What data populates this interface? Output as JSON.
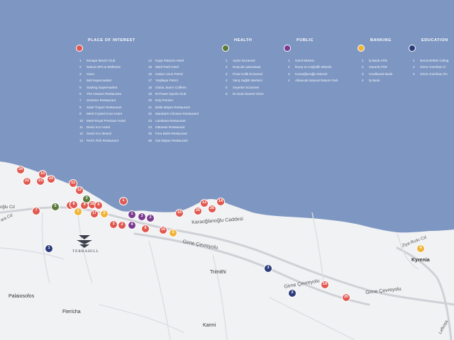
{
  "colors": {
    "sea": "#7e97c2",
    "land": "#f1f2f4",
    "interest": "#e0584f",
    "health": "#5a7a3a",
    "public": "#7b3a8f",
    "banking": "#f0b43a",
    "education": "#2b3a7a"
  },
  "legend": {
    "interest": {
      "title": "PLACE OF INTEREST",
      "col1": [
        {
          "n": "1",
          "label": "Escape Beach Club"
        },
        {
          "n": "2",
          "label": "Natura SPA & Wellness"
        },
        {
          "n": "3",
          "label": "Gavo"
        },
        {
          "n": "4",
          "label": "Beli Supermarket"
        },
        {
          "n": "5",
          "label": "Starling Supermarket"
        },
        {
          "n": "6",
          "label": "The Heaven Restaurant"
        },
        {
          "n": "7",
          "label": "Sommer Restaurant"
        },
        {
          "n": "8",
          "label": "Saint Tropez Restaurant"
        },
        {
          "n": "9",
          "label": "Merit Crystal Cove Hotel"
        },
        {
          "n": "10",
          "label": "Merit Royal Premium Hotel"
        },
        {
          "n": "11",
          "label": "Deniz Kızı Hotel"
        },
        {
          "n": "12",
          "label": "Deniz Kızı Beach"
        },
        {
          "n": "13",
          "label": "Peri's Fish Restaurant"
        }
      ],
      "col2": [
        {
          "n": "14",
          "label": "Kaya Palazzo Hotel"
        },
        {
          "n": "15",
          "label": "Merit Park Hotel"
        },
        {
          "n": "16",
          "label": "Hasan Uzun Petrol"
        },
        {
          "n": "17",
          "label": "Yeşiltepe Petrol"
        },
        {
          "n": "18",
          "label": "Gloria Jean's Coffees"
        },
        {
          "n": "19",
          "label": "M Power Sports Club"
        },
        {
          "n": "20",
          "label": "Eriş Premier"
        },
        {
          "n": "21",
          "label": "Bella Italyan Restaurant"
        },
        {
          "n": "22",
          "label": "Mandarin Chinese Restaurant"
        },
        {
          "n": "23",
          "label": "Lambusa Restaurant"
        },
        {
          "n": "24",
          "label": "Ottoman Restaurant"
        },
        {
          "n": "25",
          "label": "Fora Balık Restaurant"
        },
        {
          "n": "26",
          "label": "Gia İtalyan Restaurant"
        }
      ]
    },
    "health": {
      "title": "HEALTH",
      "items": [
        {
          "n": "1",
          "label": "Aydın Eczanesi"
        },
        {
          "n": "2",
          "label": "DuoLab Laboratuar"
        },
        {
          "n": "3",
          "label": "Pınar Kolik Eczanesi"
        },
        {
          "n": "4",
          "label": "Varış Sağlık Merkezi"
        },
        {
          "n": "5",
          "label": "Seyerler Eczanesi"
        },
        {
          "n": "6",
          "label": "Dr.Suat Günsel Girne"
        }
      ]
    },
    "public": {
      "title": "PUBLIC",
      "items": [
        {
          "n": "1",
          "label": "Gemi Müzesi"
        },
        {
          "n": "2",
          "label": "İkonş ve Coğrafik Müzesi"
        },
        {
          "n": "3",
          "label": "Karaoğlanoğlu Müzesi"
        },
        {
          "n": "4",
          "label": "Alkancak Natural Nature Park"
        }
      ]
    },
    "banking": {
      "title": "BANKING",
      "items": [
        {
          "n": "1",
          "label": "İş Bank ATM"
        },
        {
          "n": "2",
          "label": "Garanti ATM"
        },
        {
          "n": "3",
          "label": "Creditwest Bank"
        },
        {
          "n": "4",
          "label": "İş Bank"
        }
      ]
    },
    "education": {
      "title": "EDUCATION",
      "items": [
        {
          "n": "1",
          "label": "Necat British Colleg"
        },
        {
          "n": "2",
          "label": "Girne Amerikan Ü"
        },
        {
          "n": "3",
          "label": "Girne Amerikan Ün"
        }
      ]
    }
  },
  "places": [
    {
      "name": "Palaiosofos"
    },
    {
      "name": "Fterícha"
    },
    {
      "name": "Trimithi"
    },
    {
      "name": "Karmi"
    },
    {
      "name": "Kyrenia"
    }
  ],
  "roads": [
    {
      "name": "Karaoğlanoğlu Caddesi"
    },
    {
      "name": "Girne Çevreyolu"
    },
    {
      "name": "Girne Çevreyolu"
    },
    {
      "name": "Girne Çevreyolu"
    },
    {
      "name": "Ziya Rızkı Cd"
    },
    {
      "name": "oğlu Cd"
    },
    {
      "name": "ara Cd"
    },
    {
      "name": "Lefkoşa"
    }
  ],
  "logo": {
    "text": "TERRAHILL"
  },
  "markers": [
    {
      "cat": "interest",
      "n": "24"
    },
    {
      "cat": "interest",
      "n": "21"
    },
    {
      "cat": "interest",
      "n": "10"
    },
    {
      "cat": "interest",
      "n": "23"
    },
    {
      "cat": "interest",
      "n": "22"
    },
    {
      "cat": "interest",
      "n": "11"
    },
    {
      "cat": "interest",
      "n": "12"
    },
    {
      "cat": "interest",
      "n": "5"
    },
    {
      "cat": "interest",
      "n": "8"
    },
    {
      "cat": "interest",
      "n": "4"
    },
    {
      "cat": "interest",
      "n": "18"
    },
    {
      "cat": "interest",
      "n": "6"
    },
    {
      "cat": "interest",
      "n": "17"
    },
    {
      "cat": "interest",
      "n": "7"
    },
    {
      "cat": "interest",
      "n": "1"
    },
    {
      "cat": "interest",
      "n": "3"
    },
    {
      "cat": "interest",
      "n": "2"
    },
    {
      "cat": "interest",
      "n": "6"
    },
    {
      "cat": "interest",
      "n": "16"
    },
    {
      "cat": "interest",
      "n": "15"
    },
    {
      "cat": "interest",
      "n": "25"
    },
    {
      "cat": "interest",
      "n": "13"
    },
    {
      "cat": "interest",
      "n": "26"
    },
    {
      "cat": "interest",
      "n": "14"
    },
    {
      "cat": "interest",
      "n": "19"
    },
    {
      "cat": "interest",
      "n": "20"
    },
    {
      "cat": "health",
      "n": "5"
    },
    {
      "cat": "health",
      "n": "3"
    },
    {
      "cat": "public",
      "n": "1"
    },
    {
      "cat": "public",
      "n": "3"
    },
    {
      "cat": "public",
      "n": "2"
    },
    {
      "cat": "public",
      "n": "4"
    },
    {
      "cat": "banking",
      "n": "1"
    },
    {
      "cat": "banking",
      "n": "2"
    },
    {
      "cat": "banking",
      "n": "3"
    },
    {
      "cat": "banking",
      "n": "4"
    },
    {
      "cat": "education",
      "n": "1"
    },
    {
      "cat": "education",
      "n": "3"
    },
    {
      "cat": "education",
      "n": "2"
    }
  ]
}
